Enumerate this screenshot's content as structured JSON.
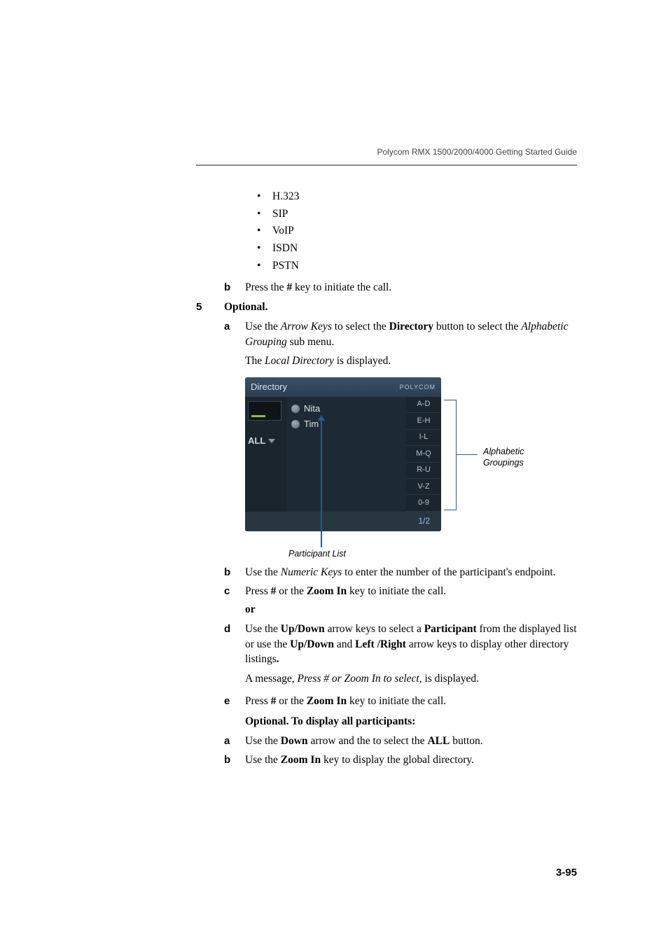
{
  "header": "Polycom RMX 1500/2000/4000 Getting Started Guide",
  "bullets": [
    "H.323",
    "SIP",
    "VoIP",
    "ISDN",
    "PSTN"
  ],
  "step_b": {
    "pre": "Press the ",
    "key": "#",
    "post": " key to initiate the call."
  },
  "step5": {
    "num": "5",
    "label": "Optional."
  },
  "s5a": {
    "pre": "Use the ",
    "arrow": "Arrow Keys",
    "mid": " to select the ",
    "dir": "Directory",
    "mid2": " button to select the ",
    "alpha": "Alphabetic Grouping",
    "post": " sub menu."
  },
  "local_dir": {
    "pre": "The ",
    "it": "Local Directory",
    "post": " is displayed."
  },
  "dirwin": {
    "title": "Directory",
    "logo": "POLYCOM",
    "all": "ALL",
    "people": [
      "Nita",
      "Tim"
    ],
    "groups": [
      "A-D",
      "E-H",
      "I-L",
      "M-Q",
      "R-U",
      "V-Z",
      "0-9"
    ],
    "footer": "1/2"
  },
  "bracket_label_1": "Alphabetic",
  "bracket_label_2": "Groupings",
  "participant_label": "Participant List",
  "s5b": {
    "pre": "Use the ",
    "it": "Numeric Keys",
    "post": " to enter the number of the participant's endpoint."
  },
  "s5c": {
    "pre": "Press ",
    "k": "#",
    "mid": " or the ",
    "zoom": "Zoom In",
    "post": " key to initiate the call."
  },
  "or": "or",
  "s5d": {
    "pre": "Use the ",
    "ud": "Up/Down",
    "mid1": " arrow keys to select a ",
    "part": "Participant",
    "mid2": " from the displayed list or use the ",
    "ud2": "Up/Down",
    "mid3": " and ",
    "lr": "Left /Right",
    "post": " arrow keys to display other directory listings",
    "dot": "."
  },
  "s5d_msg": {
    "pre": "A message, ",
    "it": "Press # or Zoom In to select,",
    "post": " is displayed."
  },
  "s5e": {
    "pre": "Press ",
    "k": "#",
    "mid": " or  the ",
    "zoom": "Zoom In",
    "post": " key to initiate the call."
  },
  "opt_heading": "Optional. To display all participants:",
  "opa": {
    "pre": "Use the ",
    "down": "Down",
    "mid": " arrow and the to select the ",
    "all": "ALL",
    "post": " button."
  },
  "opb": {
    "pre": "Use the ",
    "zoom": "Zoom In",
    "post": " key to display the global directory."
  },
  "page_num": "3-95"
}
